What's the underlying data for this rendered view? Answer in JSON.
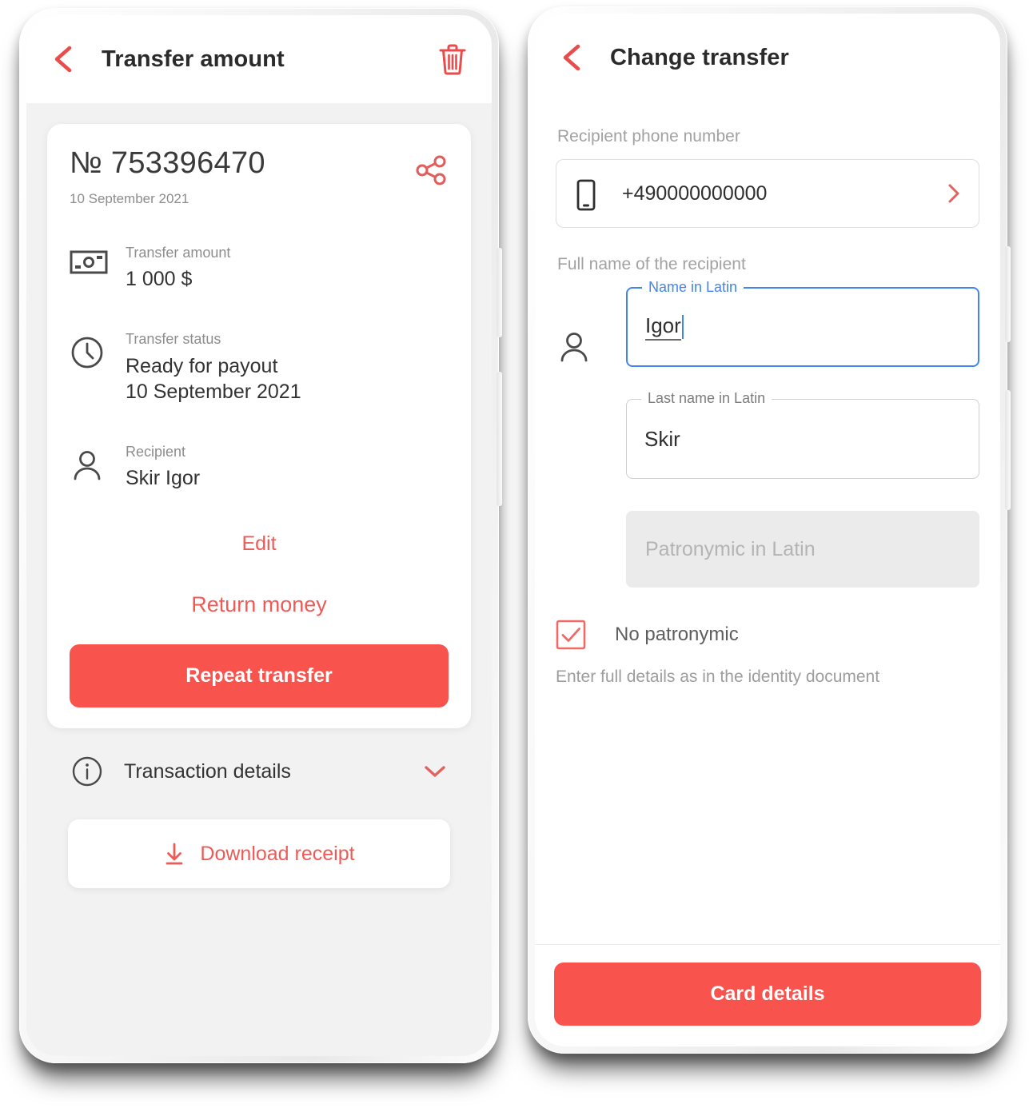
{
  "colors": {
    "accent_red": "#f9534e",
    "link_red": "#ee5b57",
    "focus_blue": "#4285ec",
    "page_bg": "#f2f2f2",
    "muted_text": "#8d8d8d"
  },
  "left_phone": {
    "appbar": {
      "back_icon": "chevron-left-icon",
      "title": "Transfer amount",
      "delete_icon": "trash-icon"
    },
    "card": {
      "account_number": "№ 753396470",
      "date": "10 September 2021",
      "share_icon": "share-icon",
      "rows": [
        {
          "icon": "banknote-icon",
          "label": "Transfer amount",
          "value": "1 000 $"
        },
        {
          "icon": "clock-icon",
          "label": "Transfer status",
          "value": "Ready for payout\n10 September 2021",
          "value_line1": "Ready for payout",
          "value_line2": "10 September 2021"
        },
        {
          "icon": "person-icon",
          "label": "Recipient",
          "value": "Skir Igor"
        }
      ],
      "edit_label": "Edit",
      "return_label": "Return money",
      "repeat_label": "Repeat transfer"
    },
    "transaction_details": {
      "icon": "info-icon",
      "label": "Transaction details",
      "chevron_icon": "chevron-down-icon"
    },
    "download_receipt": {
      "icon": "download-icon",
      "label": "Download receipt"
    }
  },
  "right_phone": {
    "appbar": {
      "back_icon": "chevron-left-icon",
      "title": "Change transfer"
    },
    "phone_field": {
      "caption": "Recipient phone number",
      "icon": "mobile-phone-icon",
      "value": "+490000000000",
      "chevron_icon": "chevron-right-icon"
    },
    "name_section": {
      "caption": "Full name of the recipient",
      "person_icon": "person-icon",
      "first_name": {
        "legend": "Name in Latin",
        "value": "Igor",
        "focused": true
      },
      "last_name": {
        "legend": "Last name in Latin",
        "value": "Skir",
        "focused": false
      },
      "patronymic": {
        "placeholder": "Patronymic in Latin",
        "value": "",
        "disabled": true
      },
      "no_patronymic": {
        "label": "No patronymic",
        "checked": true,
        "icon": "checkbox-checked-icon"
      },
      "hint": "Enter full details as in the identity document"
    },
    "bottom_button": {
      "label": "Card details"
    }
  }
}
